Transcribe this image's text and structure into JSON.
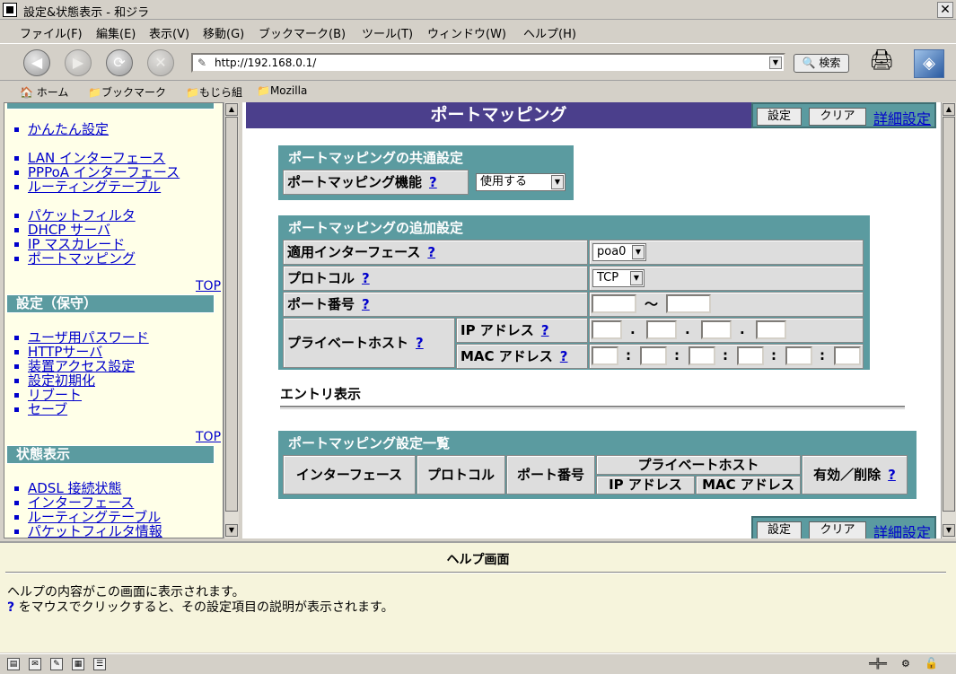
{
  "window": {
    "title": "設定&状態表示 - 和ジラ",
    "close": "✕"
  },
  "menu": [
    "ファイル(F)",
    "編集(E)",
    "表示(V)",
    "移動(G)",
    "ブックマーク(B)",
    "ツール(T)",
    "ウィンドウ(W)",
    "ヘルプ(H)"
  ],
  "nav": {
    "back": "◀",
    "forward": "▶",
    "reload": "⟳",
    "stop": "✕",
    "url": "http://192.168.0.1/",
    "search": "🔍 検索"
  },
  "bookmarks": [
    "🏠 ホーム",
    "📁ブックマーク",
    "📁もじら組",
    "📁Mozilla"
  ],
  "sidebar": {
    "links_group1": [
      "かんたん設定"
    ],
    "links_group2": [
      "LAN インターフェース",
      "PPPoA インターフェース",
      "ルーティングテーブル"
    ],
    "links_group3": [
      "パケットフィルタ",
      "DHCP サーバ",
      "IP マスカレード",
      "ポートマッピング"
    ],
    "top1": "TOP",
    "section_maint": "設定（保守）",
    "links_group4": [
      "ユーザ用パスワード",
      "HTTPサーバ",
      "装置アクセス設定",
      "設定初期化",
      "リブート",
      "セーブ"
    ],
    "top2": "TOP",
    "section_status": "状態表示",
    "links_group5": [
      "ADSL 接続状態",
      "インターフェース",
      "ルーティングテーブル",
      "パケットフィルタ情報"
    ]
  },
  "main": {
    "title": "ポートマッピング",
    "btn_set": "設定",
    "btn_clear": "クリア",
    "detail": "詳細設定",
    "common": {
      "header": "ポートマッピングの共通設定",
      "label": "ポートマッピング機能",
      "help": "?",
      "value": "使用する"
    },
    "add": {
      "header": "ポートマッピングの追加設定",
      "iface_label": "適用インターフェース",
      "iface_value": "poa0",
      "proto_label": "プロトコル",
      "proto_value": "TCP",
      "port_label": "ポート番号",
      "tilde": "〜",
      "host_label": "プライベートホスト",
      "ip_label": "IP アドレス",
      "mac_label": "MAC アドレス",
      "help": "?",
      "dot": ".",
      "colon": ":"
    },
    "entry_title": "エントリ表示",
    "list": {
      "header": "ポートマッピング設定一覧",
      "col_iface": "インターフェース",
      "col_proto": "プロトコル",
      "col_port": "ポート番号",
      "col_host": "プライベートホスト",
      "col_ip": "IP アドレス",
      "col_mac": "MAC アドレス",
      "col_action": "有効／削除",
      "help": "?"
    }
  },
  "help": {
    "title": "ヘルプ画面",
    "line1": "ヘルプの内容がこの画面に表示されます。",
    "line2_q": "?",
    "line2": " をマウスでクリックすると、その設定項目の説明が表示されます。"
  }
}
